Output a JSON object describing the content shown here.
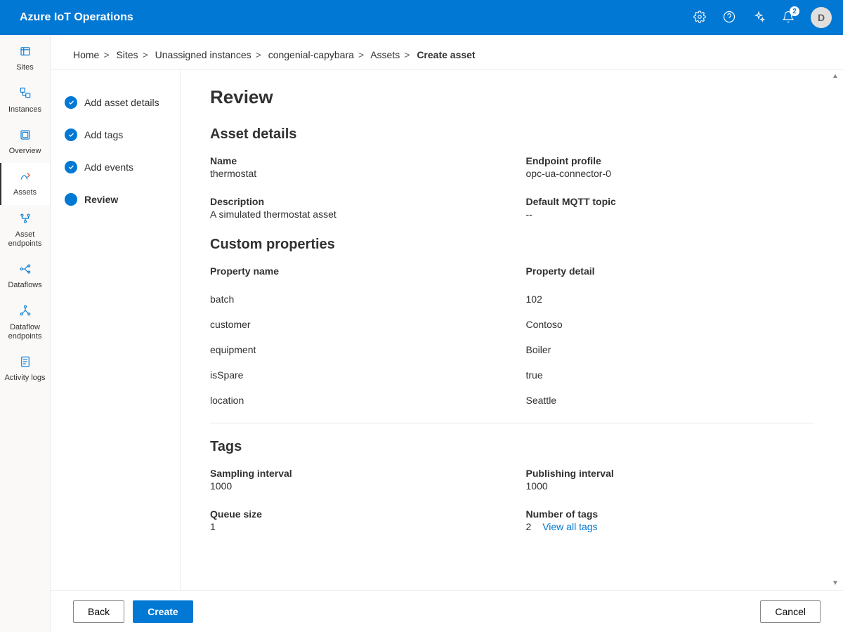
{
  "header": {
    "title": "Azure IoT Operations",
    "notification_badge": "2",
    "avatar_initial": "D"
  },
  "sidebar": {
    "items": [
      {
        "label": "Sites",
        "active": false
      },
      {
        "label": "Instances",
        "active": false
      },
      {
        "label": "Overview",
        "active": false
      },
      {
        "label": "Assets",
        "active": true
      },
      {
        "label": "Asset endpoints",
        "active": false
      },
      {
        "label": "Dataflows",
        "active": false
      },
      {
        "label": "Dataflow endpoints",
        "active": false
      },
      {
        "label": "Activity logs",
        "active": false
      }
    ]
  },
  "breadcrumb": {
    "items": [
      "Home",
      "Sites",
      "Unassigned instances",
      "congenial-capybara",
      "Assets"
    ],
    "current": "Create asset"
  },
  "steps": [
    {
      "label": "Add asset details",
      "state": "done"
    },
    {
      "label": "Add tags",
      "state": "done"
    },
    {
      "label": "Add events",
      "state": "done"
    },
    {
      "label": "Review",
      "state": "current"
    }
  ],
  "page": {
    "title": "Review"
  },
  "asset_details": {
    "heading": "Asset details",
    "name_label": "Name",
    "name_value": "thermostat",
    "endpoint_label": "Endpoint profile",
    "endpoint_value": "opc-ua-connector-0",
    "description_label": "Description",
    "description_value": "A simulated thermostat asset",
    "mqtt_label": "Default MQTT topic",
    "mqtt_value": "--"
  },
  "custom_props": {
    "heading": "Custom properties",
    "col1": "Property name",
    "col2": "Property detail",
    "rows": [
      {
        "name": "batch",
        "detail": "102"
      },
      {
        "name": "customer",
        "detail": "Contoso"
      },
      {
        "name": "equipment",
        "detail": "Boiler"
      },
      {
        "name": "isSpare",
        "detail": "true"
      },
      {
        "name": "location",
        "detail": "Seattle"
      }
    ]
  },
  "tags": {
    "heading": "Tags",
    "sampling_label": "Sampling interval",
    "sampling_value": "1000",
    "publishing_label": "Publishing interval",
    "publishing_value": "1000",
    "queue_label": "Queue size",
    "queue_value": "1",
    "num_label": "Number of tags",
    "num_value": "2",
    "view_all": "View all tags"
  },
  "footer": {
    "back": "Back",
    "create": "Create",
    "cancel": "Cancel"
  }
}
